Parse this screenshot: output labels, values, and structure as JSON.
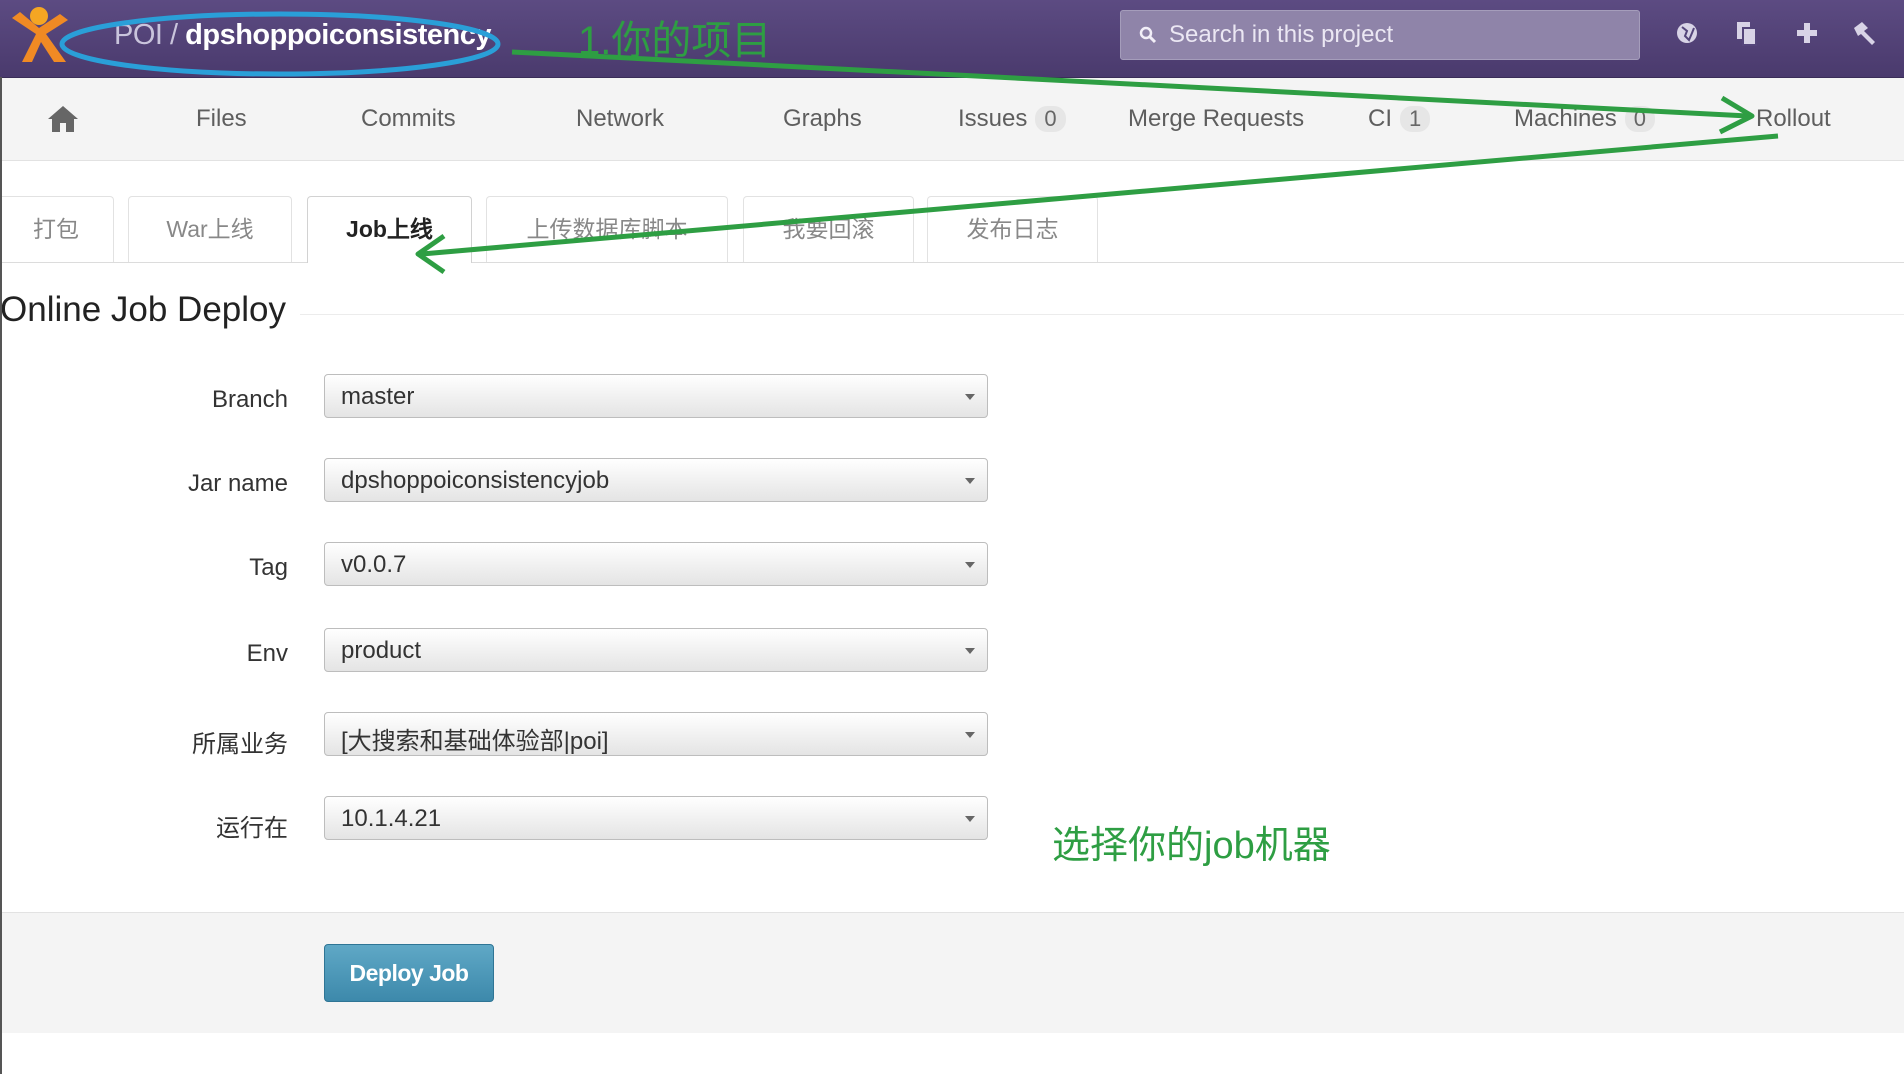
{
  "header": {
    "project_group": "POI /",
    "project_name": "dpshoppoiconsistency",
    "search_placeholder": "Search in this project",
    "icons": [
      "globe-icon",
      "copy-icon",
      "plus-icon",
      "hammer-icon"
    ]
  },
  "nav": {
    "home_icon": "home-icon",
    "items": [
      {
        "label": "Files"
      },
      {
        "label": "Commits"
      },
      {
        "label": "Network"
      },
      {
        "label": "Graphs"
      },
      {
        "label": "Issues",
        "count": "0"
      },
      {
        "label": "Merge Requests"
      },
      {
        "label": "CI",
        "count": "1"
      },
      {
        "label": "Machines",
        "count": "0"
      },
      {
        "label": "Rollout"
      }
    ]
  },
  "tabs": [
    "打包",
    "War上线",
    "Job上线",
    "上传数据库脚本",
    "我要回滚",
    "发布日志"
  ],
  "active_tab": "Job上线",
  "form": {
    "title": "Online Job Deploy",
    "fields": [
      {
        "label": "Branch",
        "value": "master"
      },
      {
        "label": "Jar name",
        "value": "dpshoppoiconsistencyjob"
      },
      {
        "label": "Tag",
        "value": "v0.0.7"
      },
      {
        "label": "Env",
        "value": "product"
      },
      {
        "label": "所属业务",
        "value": "[大搜索和基础体验部|poi]"
      },
      {
        "label": "运行在",
        "value": "10.1.4.21"
      }
    ],
    "submit_label": "Deploy Job"
  },
  "annotations": {
    "step1": "1.你的项目",
    "machine_note": "选择你的job机器",
    "color": "#2e9e43",
    "circle_color": "#2a9fd8"
  },
  "colors": {
    "header_bg": "#54457a",
    "button_bg": "#4a95b7"
  }
}
